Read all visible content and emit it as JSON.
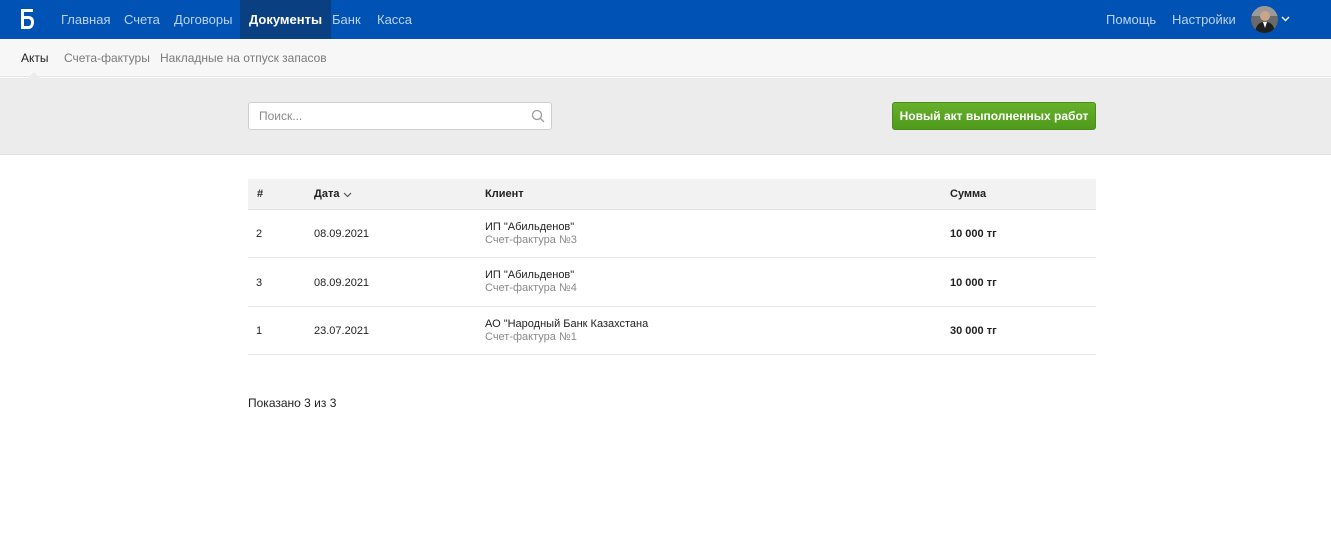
{
  "topbar": {
    "logo_letter": "Б",
    "nav": [
      "Главная",
      "Счета",
      "Договоры",
      "Документы",
      "Банк",
      "Касса"
    ],
    "active_nav": "Документы",
    "help": "Помощь",
    "settings": "Настройки"
  },
  "subnav": {
    "items": [
      "Акты",
      "Счета-фактуры",
      "Накладные на отпуск запасов"
    ],
    "active": "Акты"
  },
  "toolbar": {
    "search_placeholder": "Поиск...",
    "new_button": "Новый акт выполненных работ"
  },
  "table": {
    "columns": [
      "#",
      "Дата",
      "Клиент",
      "Сумма"
    ],
    "sorted_by": "Дата",
    "rows": [
      {
        "num": "2",
        "date": "08.09.2021",
        "client": "ИП \"Абильденов\"",
        "invoice": "Счет-фактура №3",
        "amount": "10 000 тг"
      },
      {
        "num": "3",
        "date": "08.09.2021",
        "client": "ИП \"Абильденов\"",
        "invoice": "Счет-фактура №4",
        "amount": "10 000 тг"
      },
      {
        "num": "1",
        "date": "23.07.2021",
        "client": "АО \"Народный Банк Казахстана",
        "invoice": "Счет-фактура №1",
        "amount": "30 000 тг"
      }
    ]
  },
  "footer": {
    "count_text": "Показано 3 из 3"
  },
  "colors": {
    "topbar": "#0052b4",
    "topbar_active": "#0a3f82",
    "button_green": "#5aa523"
  }
}
